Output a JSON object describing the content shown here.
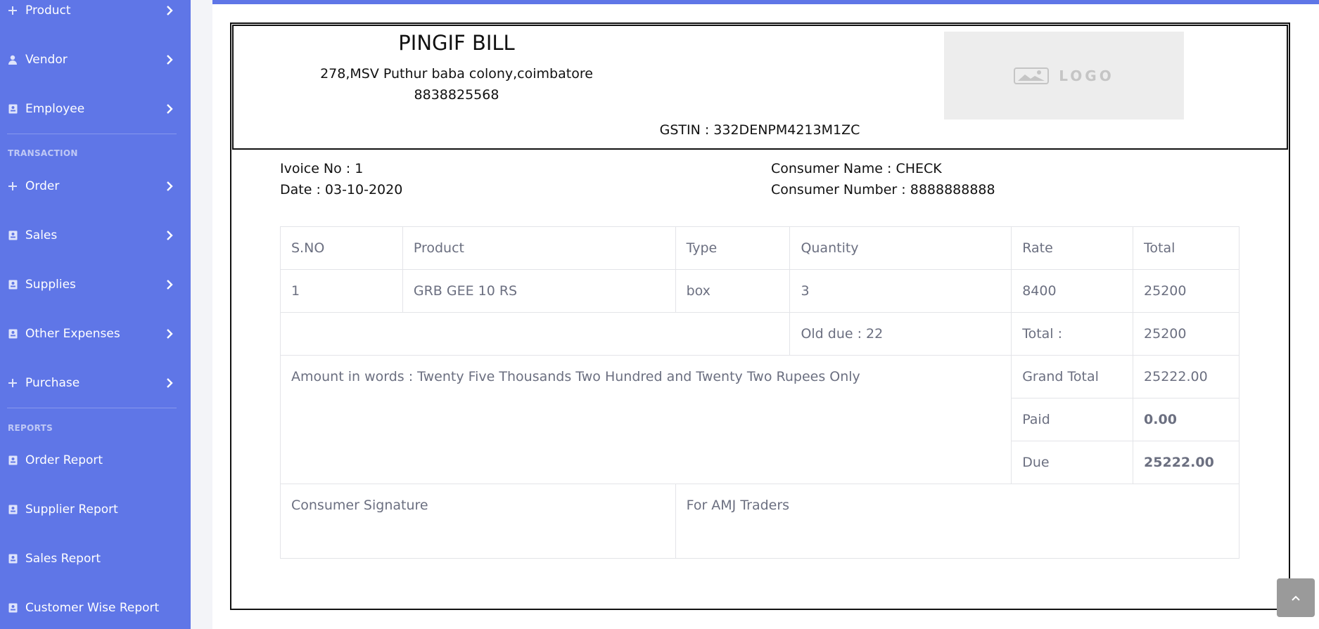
{
  "sidebar": {
    "items": [
      {
        "label": "Product",
        "icon": "plus-icon"
      },
      {
        "label": "Vendor",
        "icon": "user-icon"
      },
      {
        "label": "Employee",
        "icon": "contact-card-icon"
      },
      {
        "label": "Order",
        "icon": "plus-icon"
      },
      {
        "label": "Sales",
        "icon": "contact-card-icon"
      },
      {
        "label": "Supplies",
        "icon": "contact-card-icon"
      },
      {
        "label": "Other Expenses",
        "icon": "contact-card-icon"
      },
      {
        "label": "Purchase",
        "icon": "plus-icon"
      },
      {
        "label": "Order Report",
        "icon": "contact-card-icon"
      },
      {
        "label": "Supplier Report",
        "icon": "contact-card-icon"
      },
      {
        "label": "Sales Report",
        "icon": "contact-card-icon"
      },
      {
        "label": "Customer Wise Report",
        "icon": "contact-card-icon"
      }
    ],
    "sections": {
      "transaction": "TRANSACTION",
      "reports": "REPORTS"
    }
  },
  "bill": {
    "company_name": "PINGIF BILL",
    "address": "278,MSV Puthur baba colony,coimbatore",
    "phone": "8838825568",
    "gstin": "GSTIN : 332DENPM4213M1ZC",
    "logo_text": "LOGO",
    "invoice_no": "Ivoice No : 1",
    "date": "Date : 03-10-2020",
    "consumer_name": "Consumer Name : CHECK",
    "consumer_number": "Consumer Number : 8888888888",
    "table": {
      "headers": [
        "S.NO",
        "Product",
        "Type",
        "Quantity",
        "Rate",
        "Total"
      ],
      "row": [
        "1",
        "GRB GEE 10 RS",
        "box",
        "3",
        "8400",
        "25200"
      ],
      "old_due": "Old due : 22",
      "total_label": "Total :",
      "total_value": "25200",
      "amount_in_words": "Amount in words : Twenty Five Thousands Two Hundred and Twenty Two Rupees Only",
      "grand_total_label": "Grand Total",
      "grand_total_value": "25222.00",
      "paid_label": "Paid",
      "paid_value": "0.00",
      "due_label": "Due",
      "due_value": "25222.00",
      "consumer_signature": "Consumer Signature",
      "for_traders": "For AMJ Traders"
    }
  },
  "colors": {
    "sidebar": "#5f76e7",
    "table_text": "#6b6f80",
    "border": "#e3e4e8"
  }
}
